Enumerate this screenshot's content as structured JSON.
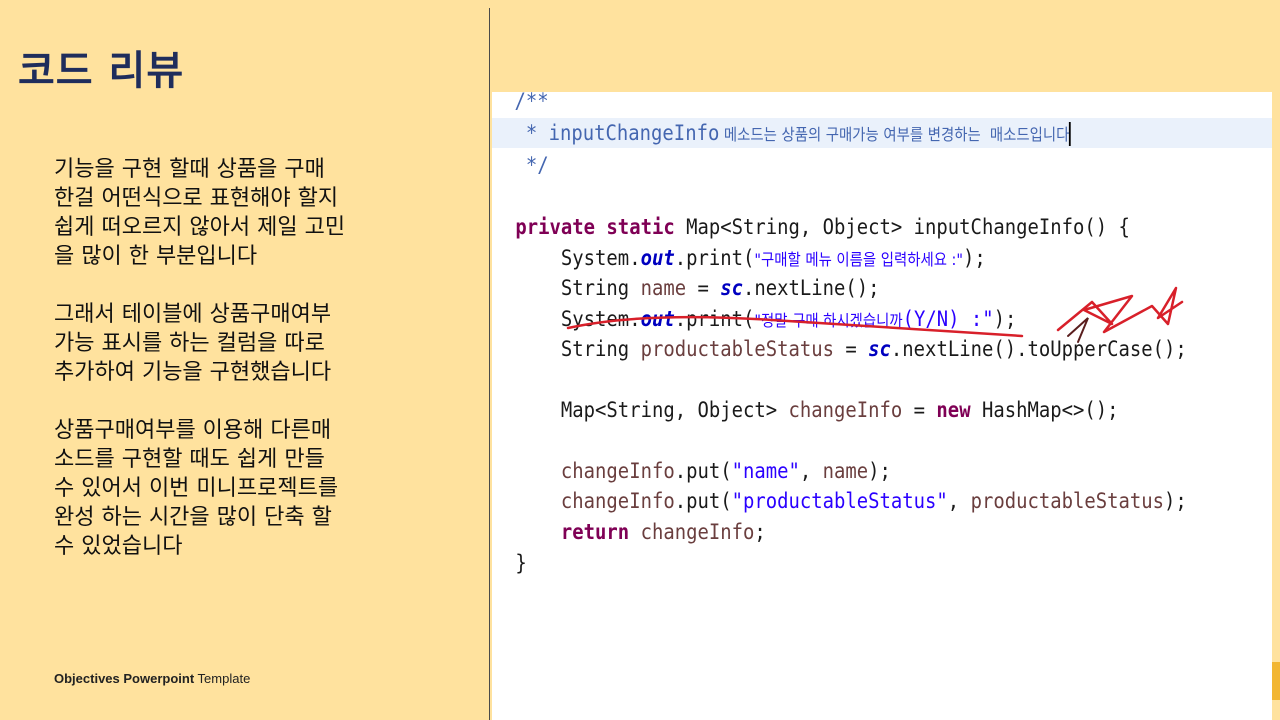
{
  "slide": {
    "title": "코드 리뷰",
    "paragraphs": [
      "기능을 구현 할때 상품을 구매\n한걸 어떤식으로 표현해야 할지\n쉽게 떠오르지 않아서 제일 고민\n을 많이 한 부분입니다",
      "그래서 테이블에 상품구매여부\n가능 표시를 하는 컬럼을 따로\n추가하여 기능을 구현했습니다",
      "상품구매여부를 이용해 다른매\n소드를 구현할 때도 쉽게 만들\n수 있어서 이번 미니프로젝트를\n완성 하는 시간을 많이 단축 할\n수 있었습니다"
    ],
    "footer_bold": "Objectives Powerpoint",
    "footer_regular": "Template"
  },
  "code": {
    "l1": "/**",
    "l2_star": " * ",
    "l2_name": "inputChangeInfo",
    "l2_desc": " 메소드는 상품의 구매가능 여부를 변경하는  매소드입니다",
    "l3": " */",
    "l4_kw": "private static",
    "l4_rest": " Map<String, Object> inputChangeInfo() {",
    "l5_a": "    System.",
    "l5_out": "out",
    "l5_b": ".print(",
    "l5_str": "\"구매할 메뉴 이름을 입력하세요 :\"",
    "l5_c": ");",
    "l6_a": "    String ",
    "l6_var": "name",
    "l6_b": " = ",
    "l6_sc": "sc",
    "l6_c": ".nextLine();",
    "l7_a": "    System.",
    "l7_out": "out",
    "l7_b": ".print(",
    "l7_str1": "\"정말 구매 하시겠습니까",
    "l7_str2": "(Y/N) :\"",
    "l7_c": ");",
    "l8_a": "    String ",
    "l8_var": "productableStatus",
    "l8_b": " = ",
    "l8_sc": "sc",
    "l8_c": ".nextLine().toUpperCase();",
    "l9_a": "    Map<String, Object> ",
    "l9_var": "changeInfo",
    "l9_b": " = ",
    "l9_kw": "new",
    "l9_c": " HashMap<>();",
    "l10_var": "    changeInfo",
    "l10_a": ".put(",
    "l10_str": "\"name\"",
    "l10_b": ", ",
    "l10_var2": "name",
    "l10_c": ");",
    "l11_var": "    changeInfo",
    "l11_a": ".put(",
    "l11_str": "\"productableStatus\"",
    "l11_b": ", ",
    "l11_var2": "productableStatus",
    "l11_c": ");",
    "l12_kw": "    return",
    "l12_var": " changeInfo",
    "l12_c": ";",
    "l13": "}"
  },
  "colors": {
    "background": "#ffe29e",
    "title": "#1f2d5c",
    "annotation": "#d8202a",
    "accent": "#f2b632"
  }
}
